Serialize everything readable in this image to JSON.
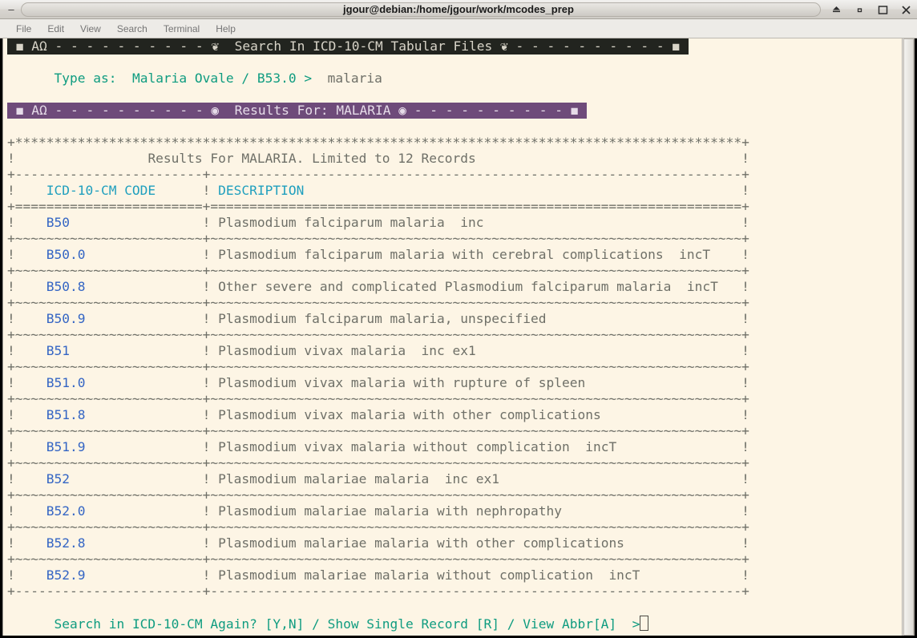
{
  "window": {
    "title": "jgour@debian:/home/jgour/work/mcodes_prep",
    "minimize_left_glyph": "–",
    "buttons": [
      {
        "name": "shade-button",
        "glyph": "▲"
      },
      {
        "name": "minimize-button",
        "glyph": "▫"
      },
      {
        "name": "maximize-button",
        "glyph": "□"
      },
      {
        "name": "close-button",
        "glyph": "✕"
      }
    ]
  },
  "menubar": {
    "items": [
      "File",
      "Edit",
      "View",
      "Search",
      "Terminal",
      "Help"
    ]
  },
  "terminal": {
    "header_bar": {
      "left_marker": "◼",
      "brand": "AΩ",
      "dashes_left": "- - - - - - - - - -",
      "ornament_left": "❦",
      "title": "Search In ICD-10-CM Tabular Files",
      "ornament_right": "❦",
      "dashes_right": "- - - - - - - - - -",
      "right_marker": "◼"
    },
    "prompt_line": {
      "label": "Type as:",
      "hint": "Malaria Ovale / B53.0 >",
      "typed_value": "malaria"
    },
    "results_bar": {
      "left_marker": "◼",
      "brand": "AΩ",
      "dashes_left": "- - - - - - - - - -",
      "ornament_left": "◉",
      "title": "Results For: MALARIA",
      "ornament_right": "◉",
      "dashes_right": "- - - - - - - - - -",
      "right_marker": "◼"
    },
    "table": {
      "caption": "Results For MALARIA. Limited to 12 Records",
      "columns": [
        "ICD-10-CM CODE",
        "DESCRIPTION"
      ],
      "rows": [
        {
          "code": "B50",
          "description": "Plasmodium falciparum malaria  inc"
        },
        {
          "code": "B50.0",
          "description": "Plasmodium falciparum malaria with cerebral complications  incT"
        },
        {
          "code": "B50.8",
          "description": "Other severe and complicated Plasmodium falciparum malaria  incT"
        },
        {
          "code": "B50.9",
          "description": "Plasmodium falciparum malaria, unspecified"
        },
        {
          "code": "B51",
          "description": "Plasmodium vivax malaria  inc ex1"
        },
        {
          "code": "B51.0",
          "description": "Plasmodium vivax malaria with rupture of spleen"
        },
        {
          "code": "B51.8",
          "description": "Plasmodium vivax malaria with other complications"
        },
        {
          "code": "B51.9",
          "description": "Plasmodium vivax malaria without complication  incT"
        },
        {
          "code": "B52",
          "description": "Plasmodium malariae malaria  inc ex1"
        },
        {
          "code": "B52.0",
          "description": "Plasmodium malariae malaria with nephropathy"
        },
        {
          "code": "B52.8",
          "description": "Plasmodium malariae malaria with other complications"
        },
        {
          "code": "B52.9",
          "description": "Plasmodium malariae malaria without complication  incT"
        }
      ]
    },
    "footer_prompt": "Search in ICD-10-CM Again? [Y,N] / Show Single Record [R] / View Abbr[A]  >",
    "colors": {
      "background": "#fdf5e5",
      "header_bar_bg": "#22241f",
      "results_bar_bg": "#6e4b7a",
      "code_color": "#3465c4",
      "heading_color": "#1f9fbe",
      "text_color": "#6f7068",
      "accent_teal": "#0f9c80"
    }
  }
}
